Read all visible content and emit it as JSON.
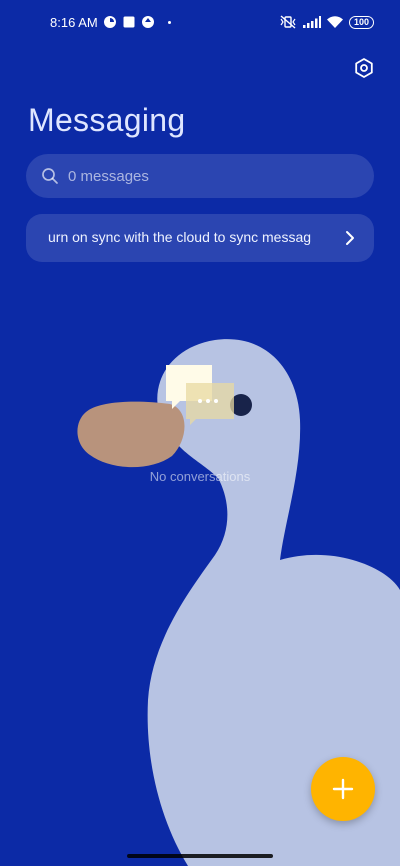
{
  "status_bar": {
    "time": "8:16 AM",
    "battery": "100"
  },
  "header": {
    "title": "Messaging",
    "settings_icon": "settings-hexagon-icon"
  },
  "search": {
    "placeholder": "0 messages",
    "icon": "search-icon"
  },
  "sync_banner": {
    "text": "urn on sync with the cloud to sync messag",
    "icon": "chevron-right-icon"
  },
  "empty_state": {
    "label": "No conversations",
    "icon": "chat-bubbles-icon"
  },
  "fab": {
    "icon": "plus-icon",
    "color": "#ffb400"
  },
  "colors": {
    "background": "#0c2aa6",
    "duck_body": "#b7c3e3",
    "duck_beak": "#b8937c",
    "duck_eye": "#18234a"
  }
}
